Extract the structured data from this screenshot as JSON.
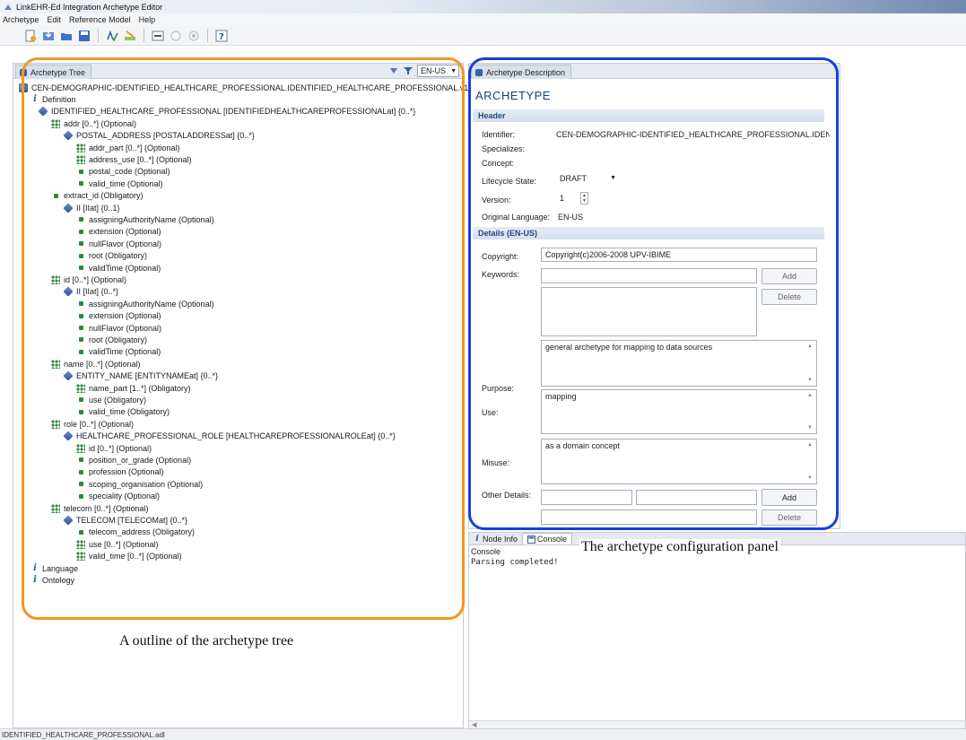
{
  "window": {
    "title": "LinkEHR-Ed Integration Archetype Editor"
  },
  "menu": [
    "Archetype",
    "Edit",
    "Reference Model",
    "Help"
  ],
  "left_panel": {
    "tab_label": "Archetype Tree",
    "language": "EN-US",
    "tree": [
      {
        "depth": 0,
        "icon": "root",
        "text": "CEN-DEMOGRAPHIC-IDENTIFIED_HEALTHCARE_PROFESSIONAL.IDENTIFIED_HEALTHCARE_PROFESSIONAL.v1"
      },
      {
        "depth": 1,
        "icon": "info",
        "text": "Definition"
      },
      {
        "depth": 2,
        "icon": "cube",
        "text": "IDENTIFIED_HEALTHCARE_PROFESSIONAL [IDENTIFIEDHEALTHCAREPROFESSIONALat] {0..*}"
      },
      {
        "depth": 3,
        "icon": "multi",
        "text": "addr [0..*] (Optional)"
      },
      {
        "depth": 4,
        "icon": "cube",
        "text": "POSTAL_ADDRESS [POSTALADDRESSat] {0..*}"
      },
      {
        "depth": 5,
        "icon": "multi",
        "text": "addr_part [0..*] (Optional)"
      },
      {
        "depth": 5,
        "icon": "multi",
        "text": "address_use [0..*] (Optional)"
      },
      {
        "depth": 5,
        "icon": "leaf",
        "text": "postal_code (Optional)"
      },
      {
        "depth": 5,
        "icon": "leaf",
        "text": "valid_time (Optional)"
      },
      {
        "depth": 3,
        "icon": "leaf",
        "text": "extract_id (Obligatory)"
      },
      {
        "depth": 4,
        "icon": "cube",
        "text": "II [IIat] {0..1}"
      },
      {
        "depth": 5,
        "icon": "leaf",
        "text": "assigningAuthorityName (Optional)"
      },
      {
        "depth": 5,
        "icon": "leaf",
        "text": "extension (Optional)"
      },
      {
        "depth": 5,
        "icon": "leaf",
        "text": "nullFlavor (Optional)"
      },
      {
        "depth": 5,
        "icon": "leaf",
        "text": "root (Obligatory)"
      },
      {
        "depth": 5,
        "icon": "leaf",
        "text": "validTime (Optional)"
      },
      {
        "depth": 3,
        "icon": "multi",
        "text": "id [0..*] (Optional)"
      },
      {
        "depth": 4,
        "icon": "cube",
        "text": "II [IIat] {0..*}"
      },
      {
        "depth": 5,
        "icon": "leaf",
        "text": "assigningAuthorityName (Optional)"
      },
      {
        "depth": 5,
        "icon": "leaf",
        "text": "extension (Optional)"
      },
      {
        "depth": 5,
        "icon": "leaf",
        "text": "nullFlavor (Optional)"
      },
      {
        "depth": 5,
        "icon": "leaf",
        "text": "root (Obligatory)"
      },
      {
        "depth": 5,
        "icon": "leaf",
        "text": "validTime (Optional)"
      },
      {
        "depth": 3,
        "icon": "multi",
        "text": "name [0..*] (Optional)"
      },
      {
        "depth": 4,
        "icon": "cube",
        "text": "ENTITY_NAME [ENTITYNAMEat] {0..*}"
      },
      {
        "depth": 5,
        "icon": "multi",
        "text": "name_part [1..*] (Obligatory)"
      },
      {
        "depth": 5,
        "icon": "leaf",
        "text": "use (Obligatory)"
      },
      {
        "depth": 5,
        "icon": "leaf",
        "text": "valid_time (Obligatory)"
      },
      {
        "depth": 3,
        "icon": "multi",
        "text": "role [0..*] (Optional)"
      },
      {
        "depth": 4,
        "icon": "cube",
        "text": "HEALTHCARE_PROFESSIONAL_ROLE [HEALTHCAREPROFESSIONALROLEat] {0..*}"
      },
      {
        "depth": 5,
        "icon": "multi",
        "text": "id [0..*] (Optional)"
      },
      {
        "depth": 5,
        "icon": "leaf",
        "text": "position_or_grade (Optional)"
      },
      {
        "depth": 5,
        "icon": "leaf",
        "text": "profession (Optional)"
      },
      {
        "depth": 5,
        "icon": "leaf",
        "text": "scoping_organisation (Optional)"
      },
      {
        "depth": 5,
        "icon": "leaf",
        "text": "speciality (Optional)"
      },
      {
        "depth": 3,
        "icon": "multi",
        "text": "telecom [0..*] (Optional)"
      },
      {
        "depth": 4,
        "icon": "cube",
        "text": "TELECOM [TELECOMat] {0..*}"
      },
      {
        "depth": 5,
        "icon": "leaf",
        "text": "telecom_address (Obligatory)"
      },
      {
        "depth": 5,
        "icon": "multi",
        "text": "use [0..*] (Optional)"
      },
      {
        "depth": 5,
        "icon": "multi",
        "text": "valid_time [0..*] (Optional)"
      },
      {
        "depth": 1,
        "icon": "info",
        "text": "Language"
      },
      {
        "depth": 1,
        "icon": "info",
        "text": "Ontology"
      }
    ],
    "status": "IDENTIFIED_HEALTHCARE_PROFESSIONAL.adl"
  },
  "right_panel": {
    "tab_label": "Archetype Description",
    "heading": "ARCHETYPE",
    "header_section": "Header",
    "identifier_label": "Identifier:",
    "identifier_value": "CEN-DEMOGRAPHIC-IDENTIFIED_HEALTHCARE_PROFESSIONAL.IDENTI",
    "specializes_label": "Specializes:",
    "concept_label": "Concept:",
    "lifecycle_label": "Lifecycle State:",
    "lifecycle_value": "DRAFT",
    "version_label": "Version:",
    "version_value": "1",
    "original_language_label": "Original Language:",
    "original_language_value": "EN-US",
    "details_section": "Details (EN-US)",
    "copyright_label": "Copyright:",
    "copyright_value": "Copyright(c)2006-2008 UPV-IBIME",
    "keywords_label": "Keywords:",
    "add_label": "Add",
    "delete_label": "Delete",
    "purpose_label": "Purpose:",
    "purpose_value": "general archetype for mapping to data sources",
    "use_label": "Use:",
    "use_value": "mapping",
    "misuse_label": "Misuse:",
    "misuse_value": "as a domain concept",
    "other_details_label": "Other Details:"
  },
  "bottom_panel": {
    "tabs": [
      "Node Info",
      "Console"
    ],
    "console_title": "Console",
    "console_text": "Parsing completed!"
  },
  "captions": {
    "left": "A outline of the archetype tree",
    "right": "The archetype configuration panel"
  },
  "colors": {
    "orange_outline": "#f4961e",
    "blue_outline": "#1740d8",
    "section_text": "#27477f"
  }
}
